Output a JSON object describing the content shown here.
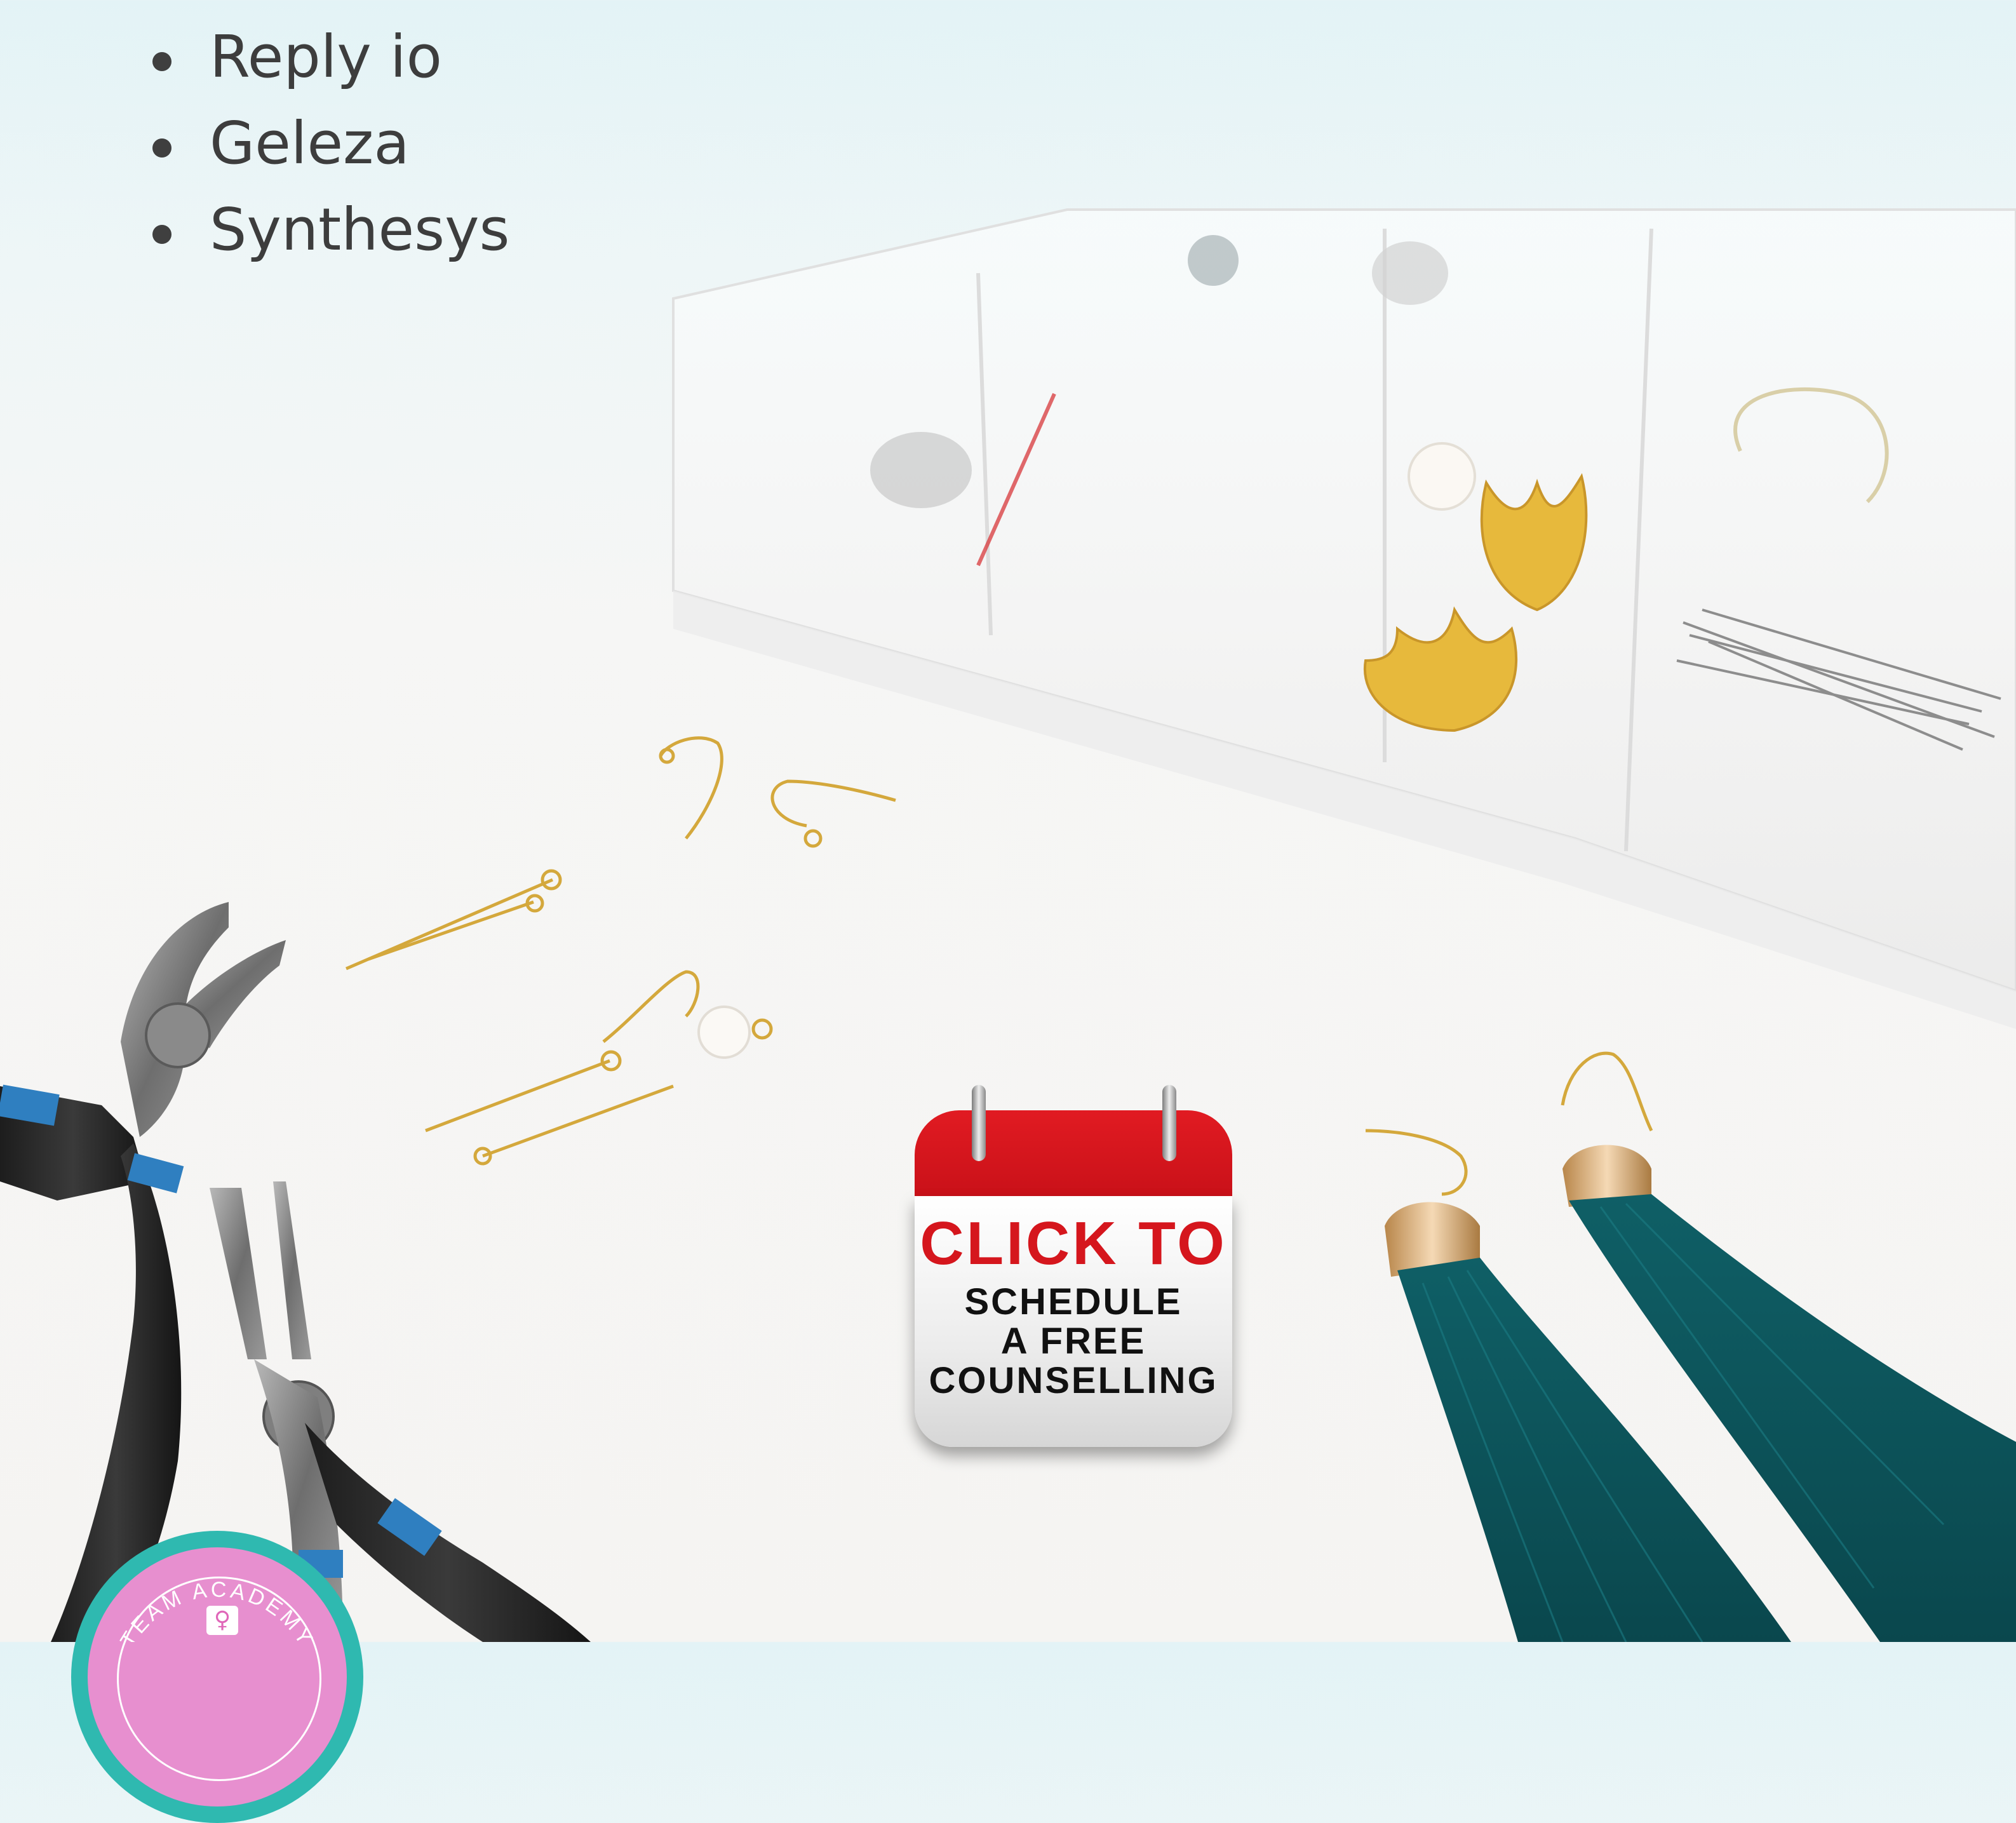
{
  "tools_list": {
    "items": [
      {
        "label": "Reply io"
      },
      {
        "label": "Geleza"
      },
      {
        "label": "Synthesys"
      }
    ]
  },
  "cta": {
    "line1": "CLICK TO",
    "line2": "SCHEDULE",
    "line3": "A FREE",
    "line4": "COUNSELLING"
  },
  "badge": {
    "text": "TEAM ACADEMY",
    "icon": "female-symbol-icon"
  },
  "colors": {
    "cta_red": "#d5161d",
    "badge_teal": "#2fb9b0",
    "badge_pink": "#e78fcf",
    "tassel_teal": "#0f5a60",
    "gold": "#e0b33d"
  }
}
